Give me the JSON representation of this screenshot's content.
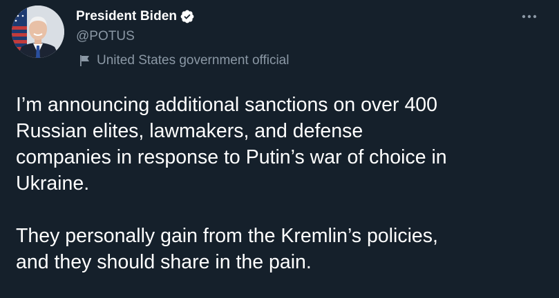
{
  "author": {
    "display_name": "President Biden",
    "handle": "@POTUS",
    "label": "United States government official",
    "verified_icon": "verified-badge-icon",
    "label_icon": "government-flag-icon"
  },
  "more_icon": "more-dots-icon",
  "tweet": {
    "paragraph_1_line_1": "I’m announcing additional sanctions on over 400",
    "paragraph_1_line_2": "Russian elites, lawmakers, and defense",
    "paragraph_1_line_3": "companies in response to Putin’s war of choice in",
    "paragraph_1_line_4": "Ukraine.",
    "paragraph_2_line_1": "They personally gain from the Kremlin’s policies,",
    "paragraph_2_line_2": "and they should share in the pain."
  },
  "colors": {
    "background": "#15202b",
    "text_primary": "#ffffff",
    "text_secondary": "#8b98a5",
    "verified_badge": "#ffffff"
  }
}
